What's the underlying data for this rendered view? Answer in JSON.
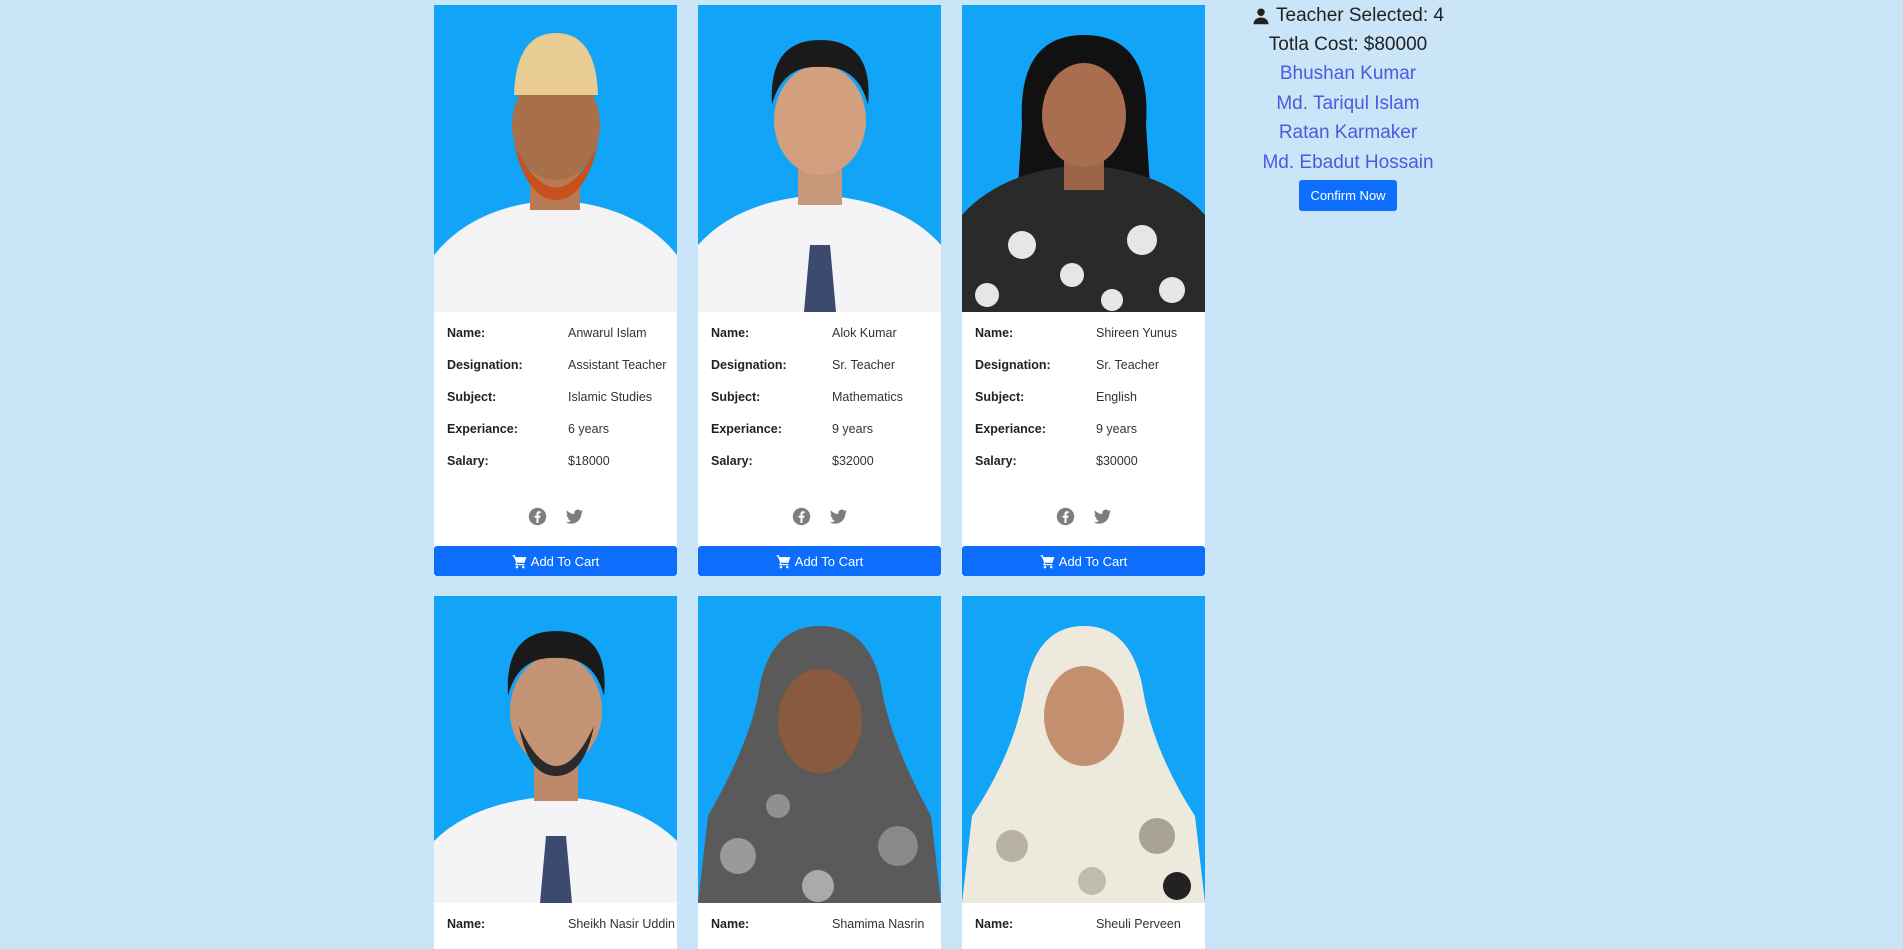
{
  "cart": {
    "selected_label": "Teacher Selected: 4",
    "cost_label": "Totla Cost: $80000",
    "names": [
      "Bhushan Kumar",
      "Md. Tariqul Islam",
      "Ratan Karmaker",
      "Md. Ebadut Hossain"
    ],
    "confirm_label": "Confirm Now"
  },
  "labels": {
    "name": "Name:",
    "designation": "Designation:",
    "subject": "Subject:",
    "experience": "Experiance:",
    "salary": "Salary:",
    "add_to_cart": "Add To Cart"
  },
  "teachers": [
    {
      "name": "Anwarul Islam",
      "designation": "Assistant Teacher",
      "subject": "Islamic Studies",
      "experience": "6 years",
      "salary": "$18000"
    },
    {
      "name": "Alok Kumar",
      "designation": "Sr. Teacher",
      "subject": "Mathematics",
      "experience": "9 years",
      "salary": "$32000"
    },
    {
      "name": "Shireen Yunus",
      "designation": "Sr. Teacher",
      "subject": "English",
      "experience": "9 years",
      "salary": "$30000"
    },
    {
      "name": "Sheikh Nasir Uddin"
    },
    {
      "name": "Shamima Nasrin"
    },
    {
      "name": "Sheuli Perveen"
    }
  ],
  "colors": {
    "background": "#c9e5f7",
    "photo_bg": "#12a4f7",
    "button": "#0d6efd",
    "cart_name": "#5058e0"
  },
  "icons": {
    "user": "user-icon",
    "cart": "cart-icon",
    "facebook": "facebook-icon",
    "twitter": "twitter-icon"
  }
}
